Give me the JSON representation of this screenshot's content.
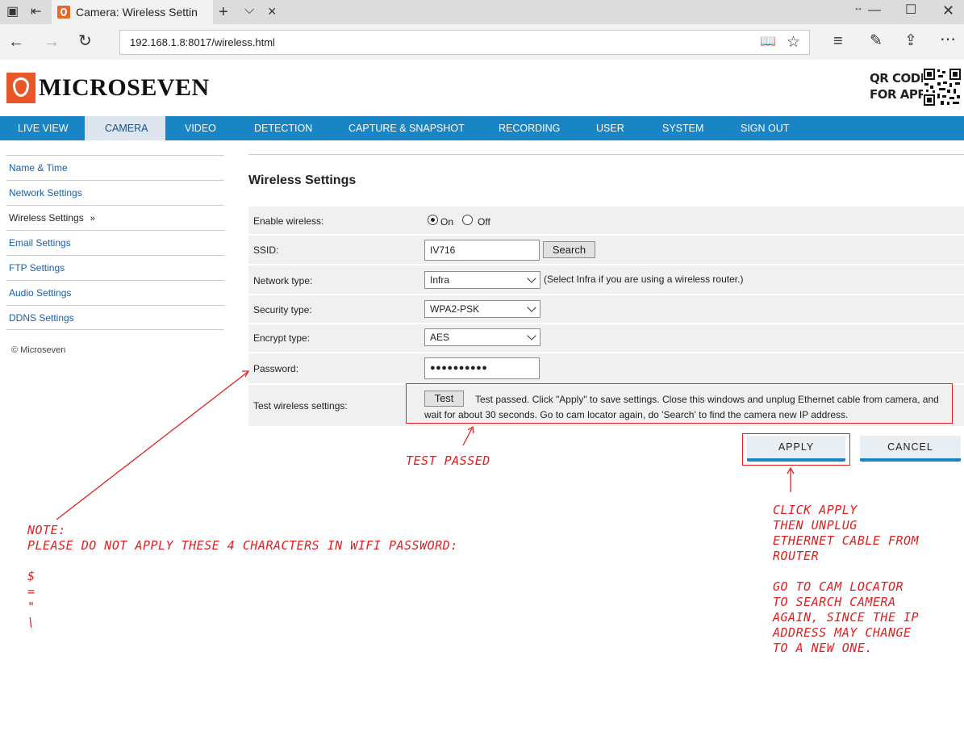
{
  "browser": {
    "tab_title": "Camera: Wireless Settin",
    "url": "192.168.1.8:8017/wireless.html"
  },
  "header": {
    "logo_text": "MICROSEVEN",
    "qr_label_line1": "QR CODE",
    "qr_label_line2": "FOR APP"
  },
  "nav": {
    "items": [
      "LIVE VIEW",
      "CAMERA",
      "VIDEO",
      "DETECTION",
      "CAPTURE & SNAPSHOT",
      "RECORDING",
      "USER",
      "SYSTEM",
      "SIGN OUT"
    ],
    "active": "CAMERA"
  },
  "sidebar": {
    "items": [
      "Name & Time",
      "Network Settings",
      "Wireless Settings",
      "Email Settings",
      "FTP Settings",
      "Audio Settings",
      "DDNS Settings"
    ],
    "current_marker": "»",
    "copyright": "© Microseven"
  },
  "form": {
    "title": "Wireless Settings",
    "enable_label": "Enable wireless:",
    "on_label": "On",
    "off_label": "Off",
    "enable_value": "On",
    "ssid_label": "SSID:",
    "ssid_value": "IV716",
    "search_button": "Search",
    "network_type_label": "Network type:",
    "network_type_value": "Infra",
    "network_type_hint": "(Select Infra if you are using a wireless router.)",
    "security_type_label": "Security type:",
    "security_type_value": "WPA2-PSK",
    "encrypt_type_label": "Encrypt type:",
    "encrypt_type_value": "AES",
    "password_label": "Password:",
    "password_value": "●●●●●●●●●●",
    "test_label": "Test wireless settings:",
    "test_button": "Test",
    "test_result_line1": "Test passed.  Click \"Apply\" to save settings.  Close this windows and unplug Ethernet cable from camera, and",
    "test_result_line2": "wait for about 30 seconds. Go to cam locator again, do 'Search' to find the camera new IP address.",
    "apply_button": "APPLY",
    "cancel_button": "CANCEL"
  },
  "annotations": {
    "test_passed": "TEST PASSED",
    "note_lines": "NOTE:\nPLEASE DO NOT APPLY THESE 4 CHARACTERS IN WIFI PASSWORD:\n\n$\n=\n\"\n\\",
    "apply_note": "CLICK APPLY\nTHEN UNPLUG\nETHERNET CABLE FROM\nROUTER\n\nGO TO CAM LOCATOR\nTO SEARCH CAMERA\nAGAIN, SINCE THE IP\nADDRESS MAY CHANGE\nTO A NEW ONE.",
    "color": "#e02020"
  }
}
